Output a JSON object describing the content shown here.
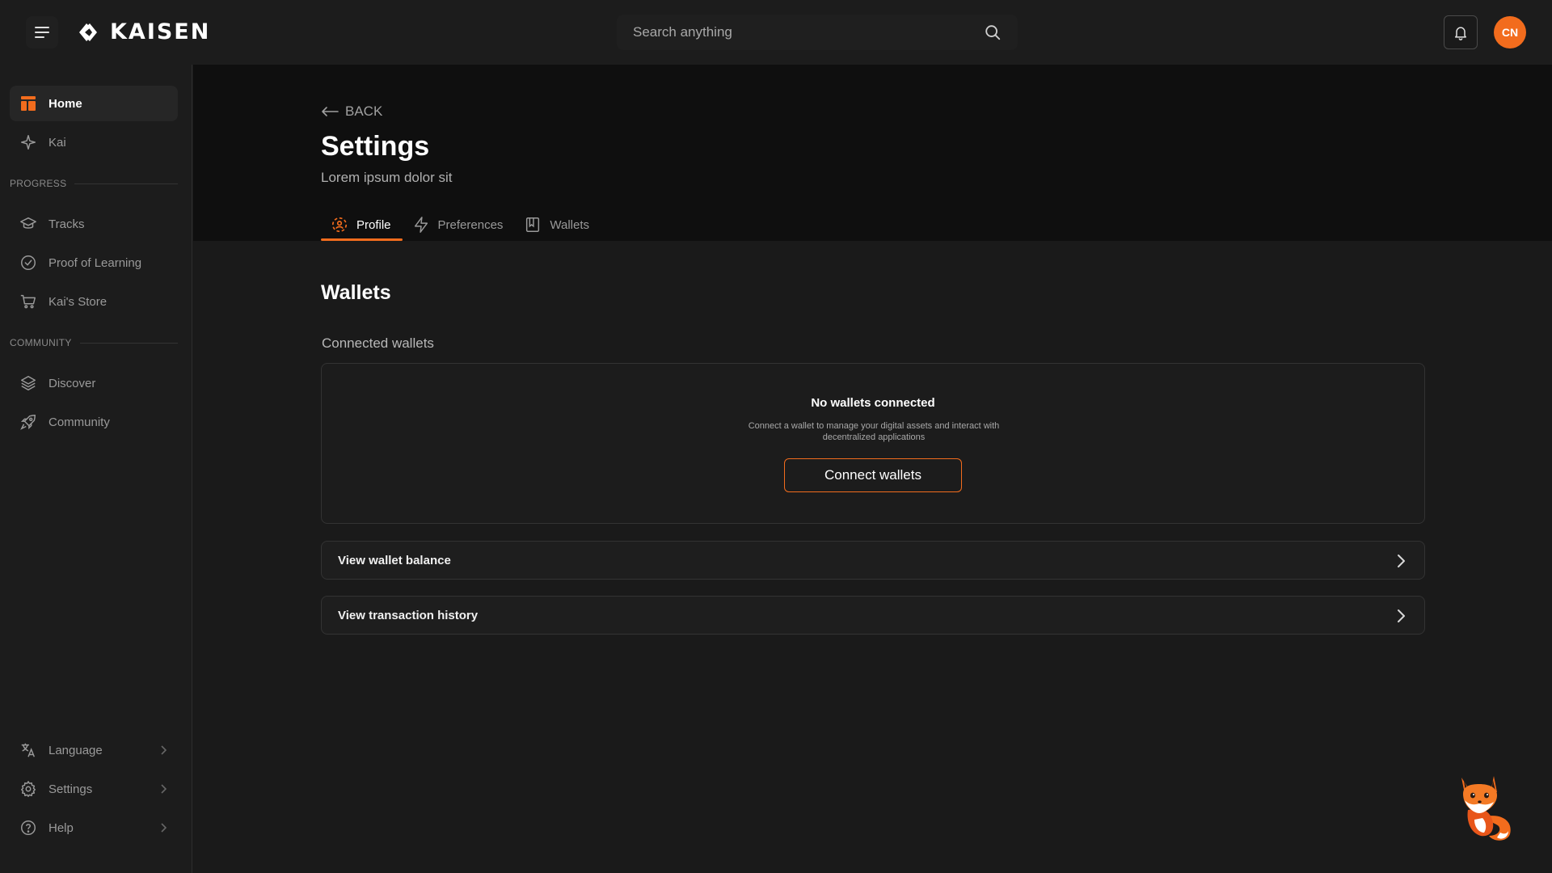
{
  "app": {
    "name": "KAISEN"
  },
  "topbar": {
    "search": {
      "placeholder": "Search anything"
    },
    "avatar_initials": "CN"
  },
  "sidebar": {
    "items_top": [
      {
        "label": "Home",
        "icon": "home-icon",
        "active": true
      },
      {
        "label": "Kai",
        "icon": "sparkle-icon"
      }
    ],
    "progress_label": "PROGRESS",
    "progress_items": [
      {
        "label": "Tracks",
        "icon": "graduation-cap-icon"
      },
      {
        "label": "Proof of Learning",
        "icon": "check-circle-icon"
      },
      {
        "label": "Kai's Store",
        "icon": "cart-icon"
      }
    ],
    "community_label": "COMMUNITY",
    "community_items": [
      {
        "label": "Discover",
        "icon": "layers-icon"
      },
      {
        "label": "Community",
        "icon": "rocket-icon"
      }
    ],
    "bottom_items": [
      {
        "label": "Language",
        "icon": "translate-icon"
      },
      {
        "label": "Settings",
        "icon": "gear-icon"
      },
      {
        "label": "Help",
        "icon": "help-circle-icon"
      }
    ]
  },
  "page": {
    "back_label": "BACK",
    "title": "Settings",
    "subtitle": "Lorem ipsum dolor sit",
    "tabs": [
      {
        "label": "Profile",
        "icon": "profile-icon",
        "active": true
      },
      {
        "label": "Preferences",
        "icon": "bolt-icon"
      },
      {
        "label": "Wallets",
        "icon": "book-icon"
      }
    ]
  },
  "wallets": {
    "title": "Wallets",
    "connected_label": "Connected wallets",
    "empty_title": "No wallets connected",
    "empty_desc": "Connect a wallet to manage your digital assets and interact with decentralized applications",
    "connect_button": "Connect wallets",
    "links": [
      {
        "label": "View wallet balance"
      },
      {
        "label": "View transaction history"
      }
    ]
  },
  "colors": {
    "accent": "#f26c1d",
    "background": "#1a1a1a",
    "hero": "#0f0f0f"
  }
}
